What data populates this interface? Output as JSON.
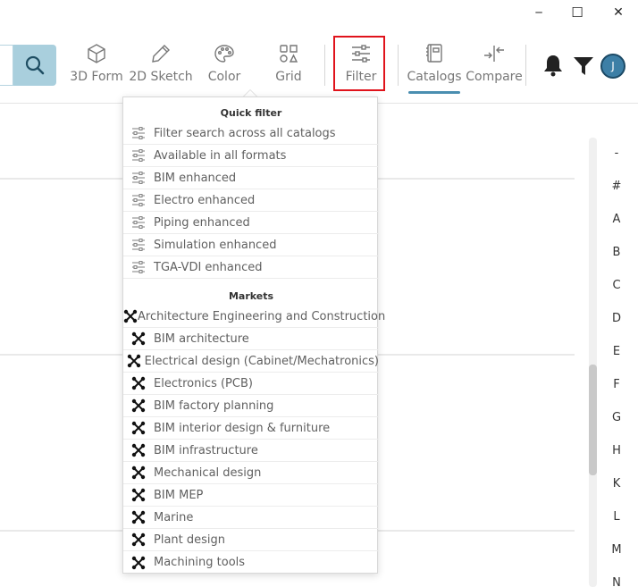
{
  "window": {
    "minimize_glyph": "─",
    "maximize_glyph": "☐",
    "close_glyph": "✕"
  },
  "toolbar": {
    "tools": [
      {
        "key": "3dform",
        "label": "3D Form",
        "icon": "cube-icon"
      },
      {
        "key": "2dsketch",
        "label": "2D Sketch",
        "icon": "pencil-icon"
      },
      {
        "key": "color",
        "label": "Color",
        "icon": "palette-icon"
      },
      {
        "key": "grid",
        "label": "Grid",
        "icon": "grid-shapes-icon"
      },
      {
        "key": "filter",
        "label": "Filter",
        "icon": "sliders-icon"
      },
      {
        "key": "catalogs",
        "label": "Catalogs",
        "icon": "catalog-book-icon"
      },
      {
        "key": "compare",
        "label": "Compare",
        "icon": "compare-arrows-icon"
      }
    ],
    "avatar_initial": "J"
  },
  "dropdown": {
    "quick_filter_title": "Quick filter",
    "quick_filter_items": [
      "Filter search across all catalogs",
      "Available in all formats",
      "BIM enhanced",
      "Electro enhanced",
      "Piping enhanced",
      "Simulation enhanced",
      "TGA-VDI enhanced"
    ],
    "markets_title": "Markets",
    "market_items": [
      "Architecture Engineering and Construction",
      "BIM architecture",
      "Electrical design (Cabinet/Mechatronics)",
      "Electronics (PCB)",
      "BIM factory planning",
      "BIM interior design & furniture",
      "BIM infrastructure",
      "Mechanical design",
      "BIM MEP",
      "Marine",
      "Plant design",
      "Machining tools"
    ]
  },
  "alphabet": [
    "-",
    "#",
    "A",
    "B",
    "C",
    "D",
    "E",
    "F",
    "G",
    "H",
    "K",
    "L",
    "M",
    "N"
  ],
  "colors": {
    "accent": "#4a8eb0",
    "highlight_border": "#e0131b",
    "search_button": "#a9cfdd",
    "avatar": "#3d7fa6"
  }
}
